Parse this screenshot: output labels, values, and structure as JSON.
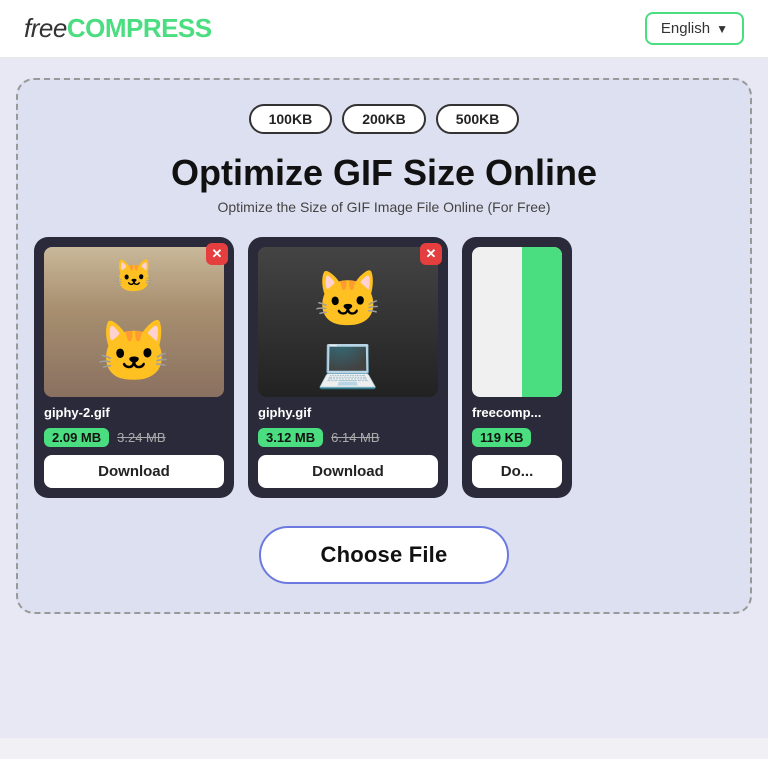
{
  "header": {
    "logo_free": "free",
    "logo_compress": "COMPRESS",
    "language_label": "English",
    "language_chevron": "▼"
  },
  "tool": {
    "size_presets": [
      "100KB",
      "200KB",
      "500KB"
    ],
    "title": "Optimize GIF Size Online",
    "subtitle": "Optimize the Size of GIF Image File Online (For Free)",
    "files": [
      {
        "name": "giphy-2.gif",
        "size_new": "2.09 MB",
        "size_old": "3.24 MB",
        "download_label": "Download",
        "type": "cat1"
      },
      {
        "name": "giphy.gif",
        "size_new": "3.12 MB",
        "size_old": "6.14 MB",
        "download_label": "Download",
        "type": "cat2"
      },
      {
        "name": "freecomp...",
        "size_new": "119 KB",
        "size_old": "",
        "download_label": "Do...",
        "type": "cat3"
      }
    ],
    "choose_file_label": "Choose File"
  }
}
